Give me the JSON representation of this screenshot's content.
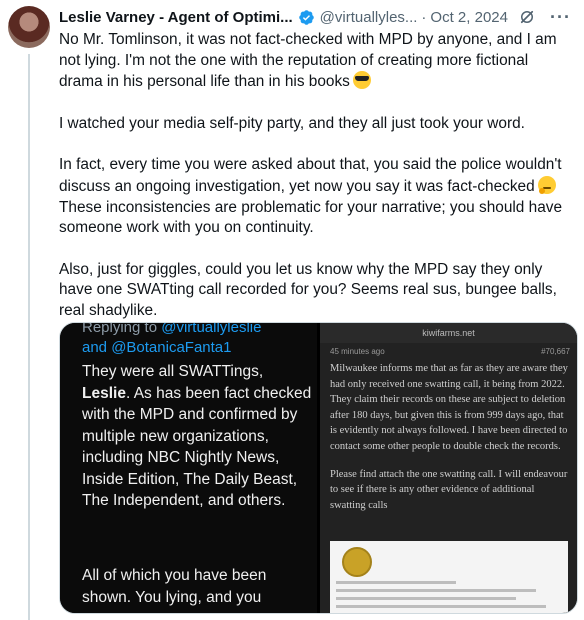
{
  "tweet": {
    "author_name": "Leslie Varney - Agent of Optimi...",
    "handle": "@virtuallyles...",
    "separator": "·",
    "date": "Oct 2, 2024",
    "more": "···",
    "paragraphs": [
      "No Mr. Tomlinson, it was not fact-checked with MPD by anyone, and I am not lying. I'm not the one with the reputation of creating more fictional drama in his personal life than in his books",
      "I watched your media self-pity party, and they all just took your word.",
      "In fact, every time you were asked about that, you said the police wouldn't discuss an ongoing investigation, yet now you say it was fact-checked",
      "These inconsistencies are problematic for your narrative; you should have someone work with you on continuity.",
      "Also, just for giggles, could you let us know why the MPD say they only have one SWATting call recorded   for  you? Seems real sus, bungee balls, real shadylike."
    ]
  },
  "media": {
    "left": {
      "replying_prefix": "Replying to ",
      "replying_handle": "@virtuallyleslie",
      "mention_line": "and @BotanicaFanta1",
      "body_a": "They were all SWATTings, ",
      "body_bold": "Leslie",
      "body_b": ". As has been fact checked with the MPD and confirmed by multiple new organizations, including NBC Nightly News, Inside Edition, The Daily Beast, The Independent, and others.",
      "body2": "All of which you have been shown. You lying, and you"
    },
    "right": {
      "site": "kiwifarms.net",
      "time": "45 minutes ago",
      "post_number": "#70,667",
      "para1": "Milwaukee informs me that as far as they are aware they had only received one swatting call, it being from 2022. They claim their records on these are subject to deletion after 180 days, but given this is from 999 days ago, that is evidently not always followed. I have been directed to contact some other people to double check the records.",
      "para2": "Please find attach the one swatting call. I will endeavour to see if there is any other evidence of additional swatting calls"
    }
  },
  "colors": {
    "text": "#0f1419",
    "secondary": "#536471",
    "verified": "#1d9bf0",
    "border": "#cfd9de"
  }
}
